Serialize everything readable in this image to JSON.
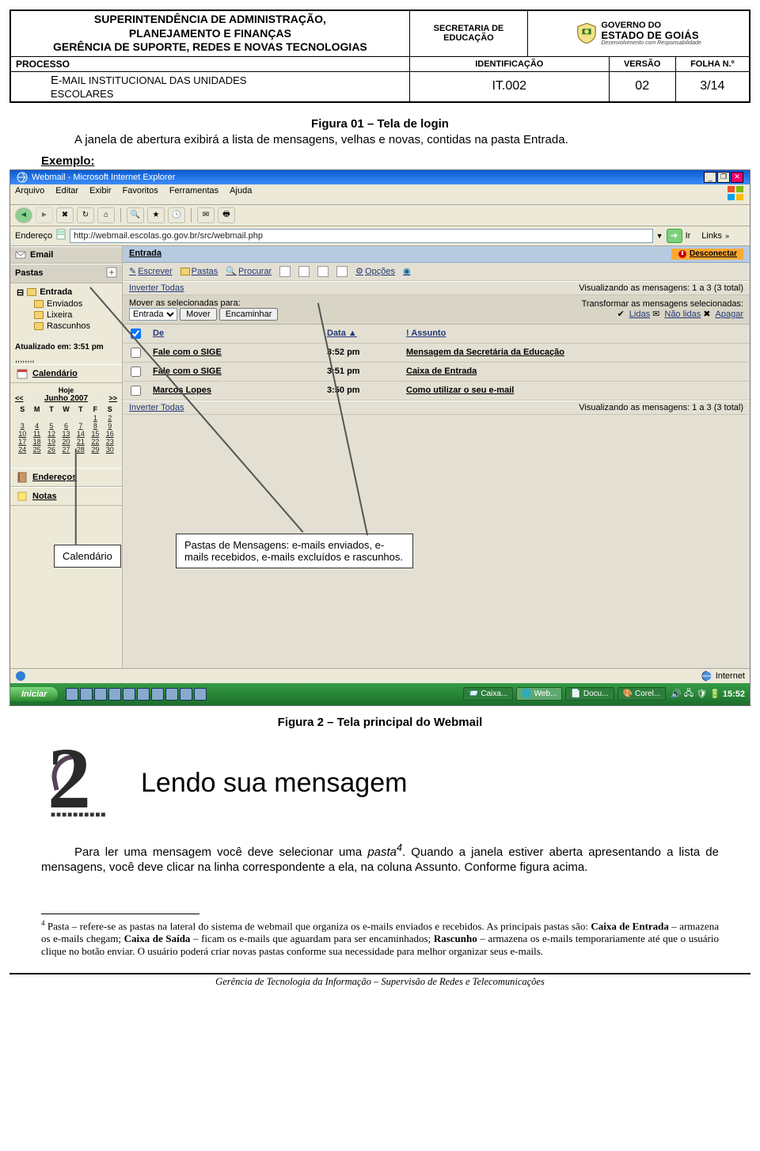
{
  "header": {
    "superintendencia_l1": "SUPERINTENDÊNCIA DE ADMINISTRAÇÃO,",
    "superintendencia_l2": "PLANEJAMENTO E FINANÇAS",
    "superintendencia_l3": "GERÊNCIA DE SUPORTE, REDES E NOVAS TECNOLOGIAS",
    "secretaria": "SECRETARIA DE EDUCAÇÃO",
    "gov_l1": "GOVERNO DO",
    "gov_l2": "ESTADO DE GOIÁS",
    "gov_l3": "Desenvolvimento com Responsabilidade",
    "processo": "PROCESSO",
    "identificacao_h": "IDENTIFICAÇÃO",
    "versao_h": "VERSÃO",
    "folha_h": "FOLHA N.º",
    "email_l1_pre": "E",
    "email_l1_rest": "-MAIL INSTITUCIONAL DAS UNIDADES",
    "email_l2": "ESCOLARES",
    "identificacao": "IT.002",
    "versao": "02",
    "folha": "3/14"
  },
  "fig1_caption": "Figura 01 – Tela de login",
  "intro_para": "A janela de abertura exibirá a lista de mensagens, velhas e novas, contidas na pasta Entrada.",
  "exemplo": "Exemplo:",
  "ie": {
    "title": "Webmail - Microsoft Internet Explorer",
    "menu": [
      "Arquivo",
      "Editar",
      "Exibir",
      "Favoritos",
      "Ferramentas",
      "Ajuda"
    ],
    "address_label": "Endereço",
    "address": "http://webmail.escolas.go.gov.br/src/webmail.php",
    "go": "Ir",
    "links": "Links"
  },
  "webmail": {
    "sidebar": {
      "email_head": "Email",
      "pastas_head": "Pastas",
      "tree": {
        "root": "Entrada",
        "items": [
          "Enviados",
          "Lixeira",
          "Rascunhos"
        ]
      },
      "atualizado": "Atualizado em: 3:51 pm",
      "dots": ",,,,,,,,",
      "calendario": "Calendário",
      "hoje": "Hoje",
      "prev": "<<",
      "next": ">>",
      "month": "Junho 2007",
      "dow": [
        "S",
        "M",
        "T",
        "W",
        "T",
        "F",
        "S"
      ],
      "weeks": [
        [
          "",
          "",
          "",
          "",
          "",
          "1",
          "2"
        ],
        [
          "3",
          "4",
          "5",
          "6",
          "7",
          "8",
          "9"
        ],
        [
          "10",
          "11",
          "12",
          "13",
          "14",
          "15",
          "16"
        ],
        [
          "17",
          "18",
          "19",
          "20",
          "21",
          "22",
          "23"
        ],
        [
          "24",
          "25",
          "26",
          "27",
          "28",
          "29",
          "30"
        ]
      ],
      "enderecos": "Endereços",
      "notas": "Notas"
    },
    "main": {
      "breadcrumb": "Entrada",
      "desconectar": "Desconectar",
      "toolbar": [
        "Escrever",
        "Pastas",
        "Procurar",
        "",
        "",
        "",
        "",
        "Opções",
        ""
      ],
      "inverter": "Inverter Todas",
      "viewing": "Visualizando as mensagens: 1 a 3 (3 total)",
      "move_label": "Mover as selecionadas para:",
      "move_select": "Entrada",
      "mover_btn": "Mover",
      "encaminhar_btn": "Encaminhar",
      "transform_label": "Transformar as mensagens selecionadas:",
      "lidas": "Lidas",
      "naolidas": "Não lidas",
      "apagar": "Apagar",
      "cols": {
        "de": "De",
        "data": "Data",
        "assunto": "Assunto"
      },
      "rows": [
        {
          "from": "Fale com o SIGE",
          "time": "3:52 pm",
          "subject": "Mensagem da Secretária da Educação"
        },
        {
          "from": "Fale com o SIGE",
          "time": "3:51 pm",
          "subject": "Caixa de Entrada"
        },
        {
          "from": "Marcos Lopes",
          "time": "3:50 pm",
          "subject": "Como utilizar o seu e-mail"
        }
      ]
    },
    "statusbar": {
      "done": "",
      "internet": "Internet"
    }
  },
  "taskbar": {
    "start": "Iniciar",
    "tabs": [
      "Caixa...",
      "Web...",
      "Docu...",
      "Corel..."
    ],
    "clock": "15:52"
  },
  "callouts": {
    "calendario": "Calendário",
    "pastas": "Pastas de Mensagens: e-mails enviados, e-mails recebidos, e-mails excluídos e rascunhos."
  },
  "fig2_caption": "Figura 2 – Tela principal do Webmail",
  "section_title": "Lendo sua mensagem",
  "body_para_1_pre": "Para ler uma mensagem você deve selecionar uma ",
  "body_para_1_ital": "pasta",
  "body_para_1_sup": "4",
  "body_para_1_post": ". Quando a janela estiver aberta apresentando a lista de mensagens, você deve clicar na linha correspondente a ela, na coluna Assunto. Conforme figura acima.",
  "footnote": {
    "sup": "4",
    "text_a": " Pasta – refere-se as pastas na lateral do sistema de webmail que organiza os e-mails enviados e recebidos. As principais pastas são: ",
    "caixa_entrada": "Caixa de Entrada",
    "text_b": " – armazena os e-mails chegam; ",
    "caixa_saida": "Caixa de Saída",
    "text_c": " – ficam os e-mails que aguardam para ser encaminhados; ",
    "rascunho": "Rascunho",
    "text_d": " – armazena os e-mails temporariamente até que o usuário clique no botão enviar. O usuário poderá criar novas pastas conforme sua necessidade para melhor organizar seus e-mails."
  },
  "footer": "Gerência de Tecnologia da Informação – Supervisão de Redes e Telecomunicações"
}
